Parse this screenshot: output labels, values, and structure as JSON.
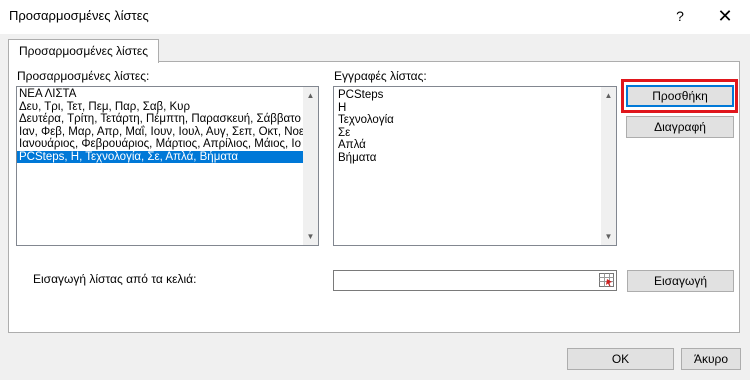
{
  "window": {
    "title": "Προσαρμοσμένες λίστες",
    "help_glyph": "?",
    "close_glyph": "✕"
  },
  "tab": {
    "label": "Προσαρμοσμένες λίστες"
  },
  "custom_lists": {
    "label": "Προσαρμοσμένες λίστες:",
    "items": [
      "ΝΕΑ ΛΙΣΤΑ",
      "Δευ, Τρι, Τετ, Πεμ, Παρ, Σαβ, Κυρ",
      "Δευτέρα, Τρίτη, Τετάρτη, Πέμπτη, Παρασκευή, Σάββατο",
      "Ιαν, Φεβ, Μαρ, Απρ, Μαΐ, Ιουν, Ιουλ, Αυγ, Σεπ, Οκτ, Νοε,",
      "Ιανουάριος, Φεβρουάριος, Μάρτιος, Απρίλιος, Μάιος, Ιο",
      "PCSteps, Η, Τεχνολογία, Σε, Απλά, Βήματα"
    ],
    "selected_index": 5
  },
  "list_entries": {
    "label": "Εγγραφές λίστας:",
    "items": [
      "PCSteps",
      "Η",
      "Τεχνολογία",
      "Σε",
      "Απλά",
      "Βήματα"
    ]
  },
  "buttons": {
    "add": "Προσθήκη",
    "delete": "Διαγραφή",
    "import": "Εισαγωγή",
    "ok": "OK",
    "cancel": "Άκυρο"
  },
  "import_field": {
    "label": "Εισαγωγή λίστας από τα κελιά:",
    "value": ""
  },
  "colors": {
    "selection": "#0078d7",
    "highlight_frame": "#e0161c"
  }
}
